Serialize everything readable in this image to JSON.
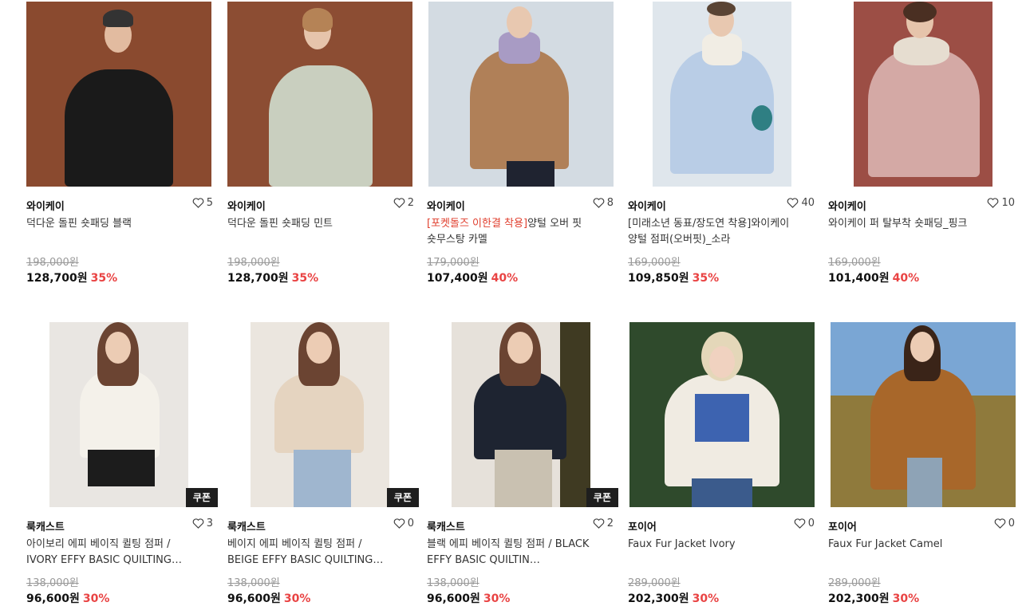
{
  "products": [
    {
      "brand": "와이케이",
      "likes": "5",
      "name": "덕다운 돌핀 숏패딩 블랙",
      "name_hl": "",
      "orig": "198,000원",
      "price": "128,700원",
      "disc": "35%",
      "coupon": ""
    },
    {
      "brand": "와이케이",
      "likes": "2",
      "name": "덕다운 돌핀 숏패딩 민트",
      "name_hl": "",
      "orig": "198,000원",
      "price": "128,700원",
      "disc": "35%",
      "coupon": ""
    },
    {
      "brand": "와이케이",
      "likes": "8",
      "name": "양털 오버 핏 숏무스탕 카멜",
      "name_hl": "[포켓돌즈 이한결 착용]",
      "orig": "179,000원",
      "price": "107,400원",
      "disc": "40%",
      "coupon": ""
    },
    {
      "brand": "와이케이",
      "likes": "40",
      "name": "[미래소년 동표/장도연 착용]와이케이 양털 점퍼(오버핏)_소라",
      "name_hl": "",
      "orig": "169,000원",
      "price": "109,850원",
      "disc": "35%",
      "coupon": ""
    },
    {
      "brand": "와이케이",
      "likes": "10",
      "name": "와이케이 퍼 탈부착 숏패딩_핑크",
      "name_hl": "",
      "orig": "169,000원",
      "price": "101,400원",
      "disc": "40%",
      "coupon": ""
    },
    {
      "brand": "룩캐스트",
      "likes": "3",
      "name": "아이보리 에피 베이직 퀼팅 점퍼 / IVORY EFFY BASIC QUILTING…",
      "name_hl": "",
      "orig": "138,000원",
      "price": "96,600원",
      "disc": "30%",
      "coupon": "쿠폰"
    },
    {
      "brand": "룩캐스트",
      "likes": "0",
      "name": "베이지 에피 베이직 퀼팅 점퍼 / BEIGE EFFY BASIC QUILTING…",
      "name_hl": "",
      "orig": "138,000원",
      "price": "96,600원",
      "disc": "30%",
      "coupon": "쿠폰"
    },
    {
      "brand": "룩캐스트",
      "likes": "2",
      "name": "블랙 에피 베이직 퀼팅 점퍼 / BLACK EFFY BASIC QUILTIN…",
      "name_hl": "",
      "orig": "138,000원",
      "price": "96,600원",
      "disc": "30%",
      "coupon": "쿠폰"
    },
    {
      "brand": "포이어",
      "likes": "0",
      "name": "Faux Fur Jacket Ivory",
      "name_hl": "",
      "orig": "289,000원",
      "price": "202,300원",
      "disc": "30%",
      "coupon": ""
    },
    {
      "brand": "포이어",
      "likes": "0",
      "name": "Faux Fur Jacket Camel",
      "name_hl": "",
      "orig": "289,000원",
      "price": "202,300원",
      "disc": "30%",
      "coupon": ""
    }
  ],
  "colors": {
    "discount": "#e94343",
    "highlight": "#e03e2d",
    "coupon_bg": "#1e1e1e"
  }
}
